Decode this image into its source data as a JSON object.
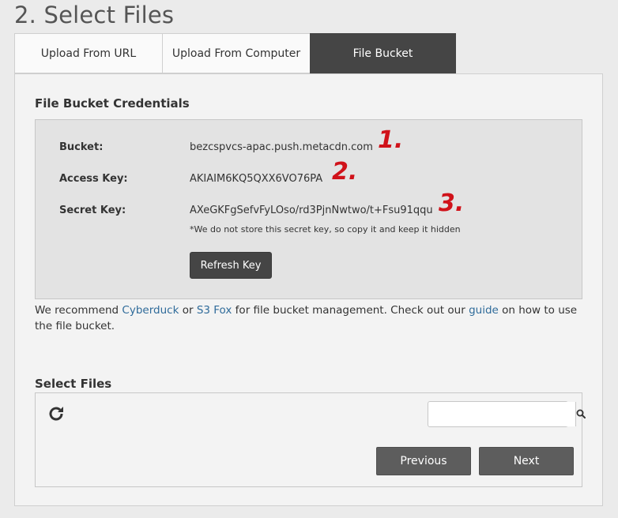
{
  "page": {
    "title": "2. Select Files"
  },
  "tabs": [
    {
      "label": "Upload From URL",
      "active": false
    },
    {
      "label": "Upload From Computer",
      "active": false
    },
    {
      "label": "File Bucket",
      "active": true
    }
  ],
  "credentials": {
    "heading": "File Bucket Credentials",
    "bucket_label": "Bucket:",
    "bucket_value": "bezcspvcs-apac.push.metacdn.com",
    "access_key_label": "Access Key:",
    "access_key_value": "AKIAIM6KQ5QXX6VO76PA",
    "secret_key_label": "Secret Key:",
    "secret_key_value": "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",
    "secret_note": "*We do not store this secret key, so copy it and keep it hidden",
    "refresh_label": "Refresh Key",
    "markers": [
      "1.",
      "2.",
      "3."
    ],
    "marker_color": "#d0121a"
  },
  "recommend": {
    "text1": "We recommend ",
    "link1": "Cyberduck",
    "text2": " or ",
    "link2": "S3 Fox",
    "text3": " for file bucket management. Check out our ",
    "link3": "guide",
    "text4": " on how to use the file bucket."
  },
  "files": {
    "heading": "Select Files",
    "search_value": "",
    "previous_label": "Previous",
    "next_label": "Next",
    "icons": {
      "refresh": "refresh-icon",
      "search": "search-icon"
    }
  },
  "colors": {
    "active_tab": "#454545",
    "link": "#2f6b9a",
    "button": "#5d5d5d"
  }
}
